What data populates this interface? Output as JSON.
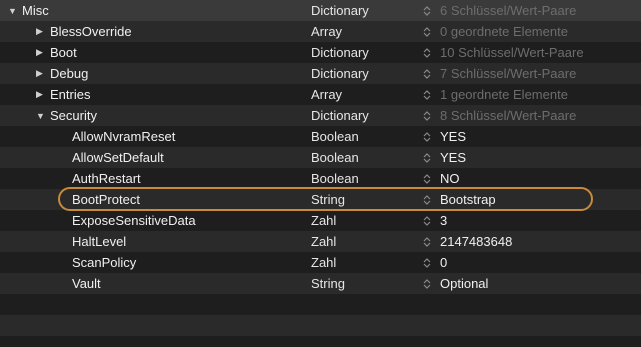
{
  "rows": [
    {
      "key": "Misc",
      "type": "Dictionary",
      "value": "6 Schlüssel/Wert-Paare",
      "disclosure": "▼"
    },
    {
      "key": "BlessOverride",
      "type": "Array",
      "value": "0 geordnete Elemente",
      "disclosure": "▶"
    },
    {
      "key": "Boot",
      "type": "Dictionary",
      "value": "10 Schlüssel/Wert-Paare",
      "disclosure": "▶"
    },
    {
      "key": "Debug",
      "type": "Dictionary",
      "value": "7 Schlüssel/Wert-Paare",
      "disclosure": "▶"
    },
    {
      "key": "Entries",
      "type": "Array",
      "value": "1 geordnete Elemente",
      "disclosure": "▶"
    },
    {
      "key": "Security",
      "type": "Dictionary",
      "value": "8 Schlüssel/Wert-Paare",
      "disclosure": "▼"
    },
    {
      "key": "AllowNvramReset",
      "type": "Boolean",
      "value": "YES"
    },
    {
      "key": "AllowSetDefault",
      "type": "Boolean",
      "value": "YES"
    },
    {
      "key": "AuthRestart",
      "type": "Boolean",
      "value": "NO"
    },
    {
      "key": "BootProtect",
      "type": "String",
      "value": "Bootstrap"
    },
    {
      "key": "ExposeSensitiveData",
      "type": "Zahl",
      "value": "3"
    },
    {
      "key": "HaltLevel",
      "type": "Zahl",
      "value": "2147483648"
    },
    {
      "key": "ScanPolicy",
      "type": "Zahl",
      "value": "0"
    },
    {
      "key": "Vault",
      "type": "String",
      "value": "Optional"
    }
  ],
  "colors": {
    "highlight_border": "#c98a3a",
    "header_row": "#3a3a3a",
    "dim_text": "#6d6d6d"
  }
}
